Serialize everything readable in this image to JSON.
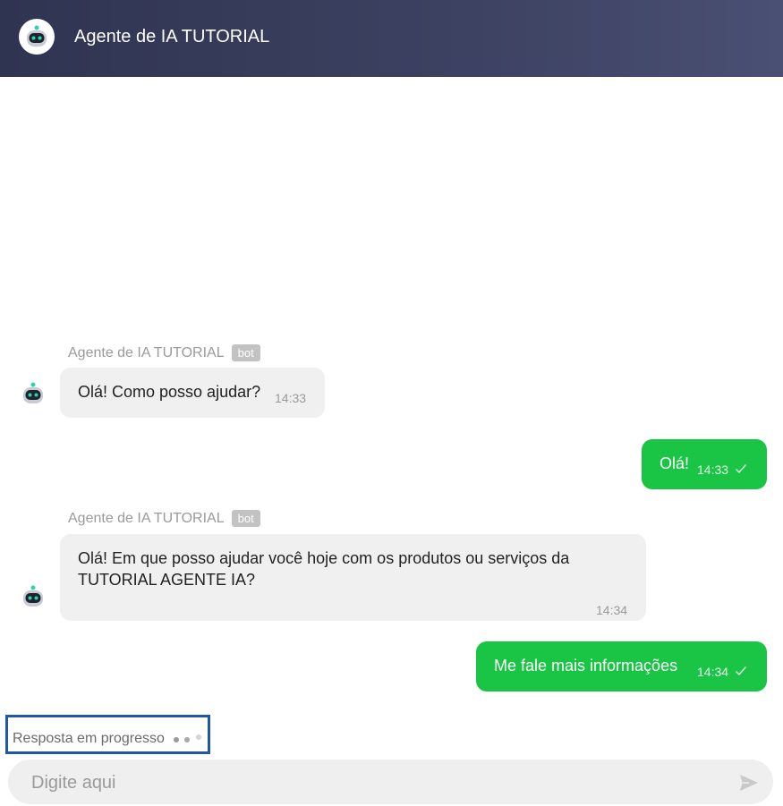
{
  "header": {
    "title": "Agente de IA TUTORIAL",
    "avatar_icon": "robot-icon"
  },
  "messages": [
    {
      "from": "bot",
      "sender": "Agente de IA TUTORIAL",
      "badge": "bot",
      "text": "Olá! Como posso ajudar?",
      "time": "14:33"
    },
    {
      "from": "user",
      "text": "Olá!",
      "time": "14:33",
      "status_icon": "check-icon"
    },
    {
      "from": "bot",
      "sender": "Agente de IA TUTORIAL",
      "badge": "bot",
      "text": "Olá! Em que posso ajudar você hoje com os produtos ou serviços da TUTORIAL AGENTE IA?",
      "time": "14:34"
    },
    {
      "from": "user",
      "text": "Me fale mais informações",
      "time": "14:34",
      "status_icon": "check-icon"
    }
  ],
  "typing": {
    "text": "Resposta em progresso"
  },
  "composer": {
    "placeholder": "Digite aqui",
    "send_icon": "send-icon"
  },
  "colors": {
    "header": "#3d4262",
    "user_bubble": "#1ac444",
    "bot_bubble": "#f0f0f0",
    "highlight": "#1e56a8"
  }
}
